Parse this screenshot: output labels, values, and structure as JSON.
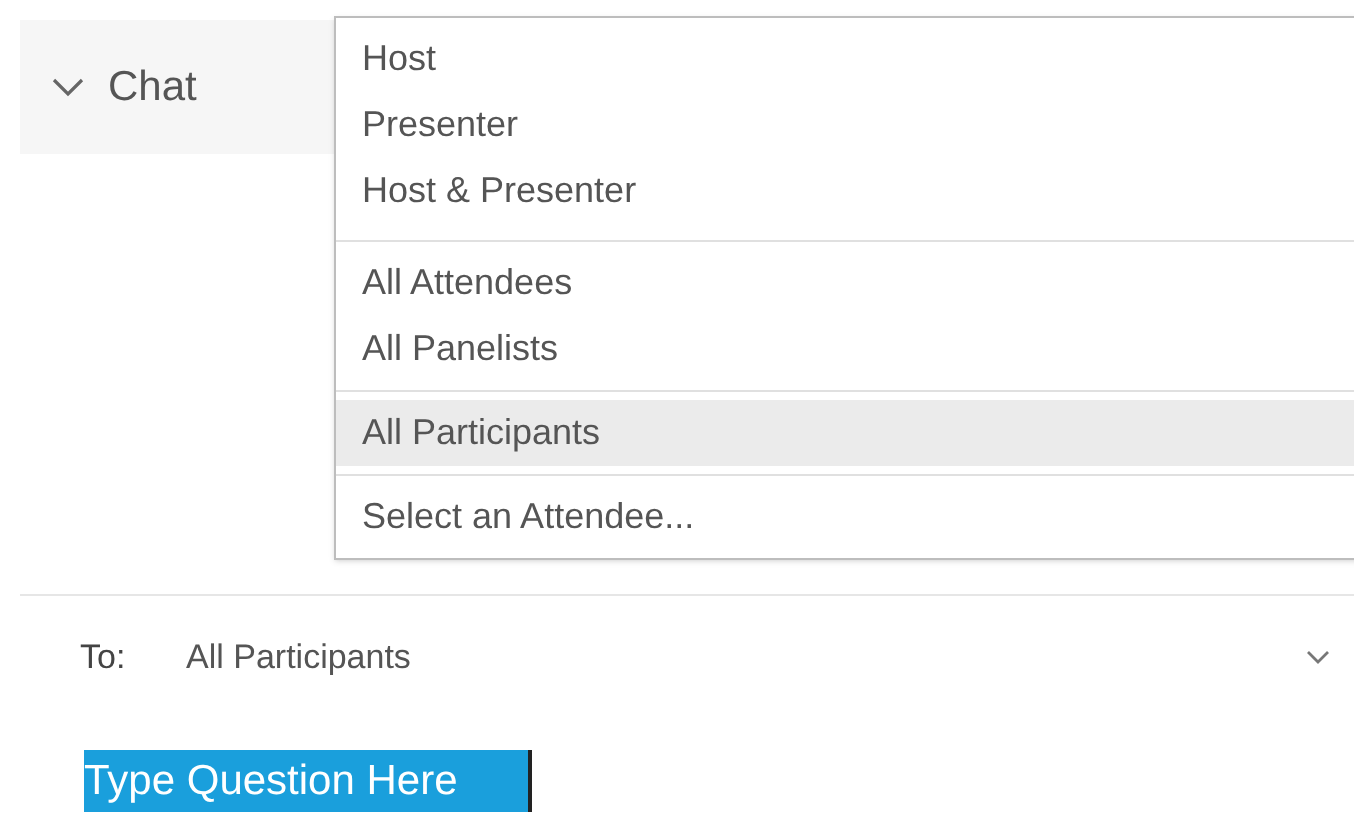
{
  "chat_header": {
    "label": "Chat",
    "expanded": true
  },
  "recipient_menu": {
    "groups": [
      {
        "items": [
          {
            "label": "Host",
            "selected": false
          },
          {
            "label": "Presenter",
            "selected": false
          },
          {
            "label": "Host & Presenter",
            "selected": false
          }
        ]
      },
      {
        "items": [
          {
            "label": "All Attendees",
            "selected": false
          },
          {
            "label": "All Panelists",
            "selected": false
          }
        ]
      },
      {
        "items": [
          {
            "label": "All Participants",
            "selected": true
          }
        ]
      },
      {
        "items": [
          {
            "label": "Select an Attendee...",
            "selected": false
          }
        ]
      }
    ]
  },
  "to_field": {
    "label": "To:",
    "value": "All Participants"
  },
  "question_box": {
    "value": "Type Question Here",
    "highlighted": true
  }
}
